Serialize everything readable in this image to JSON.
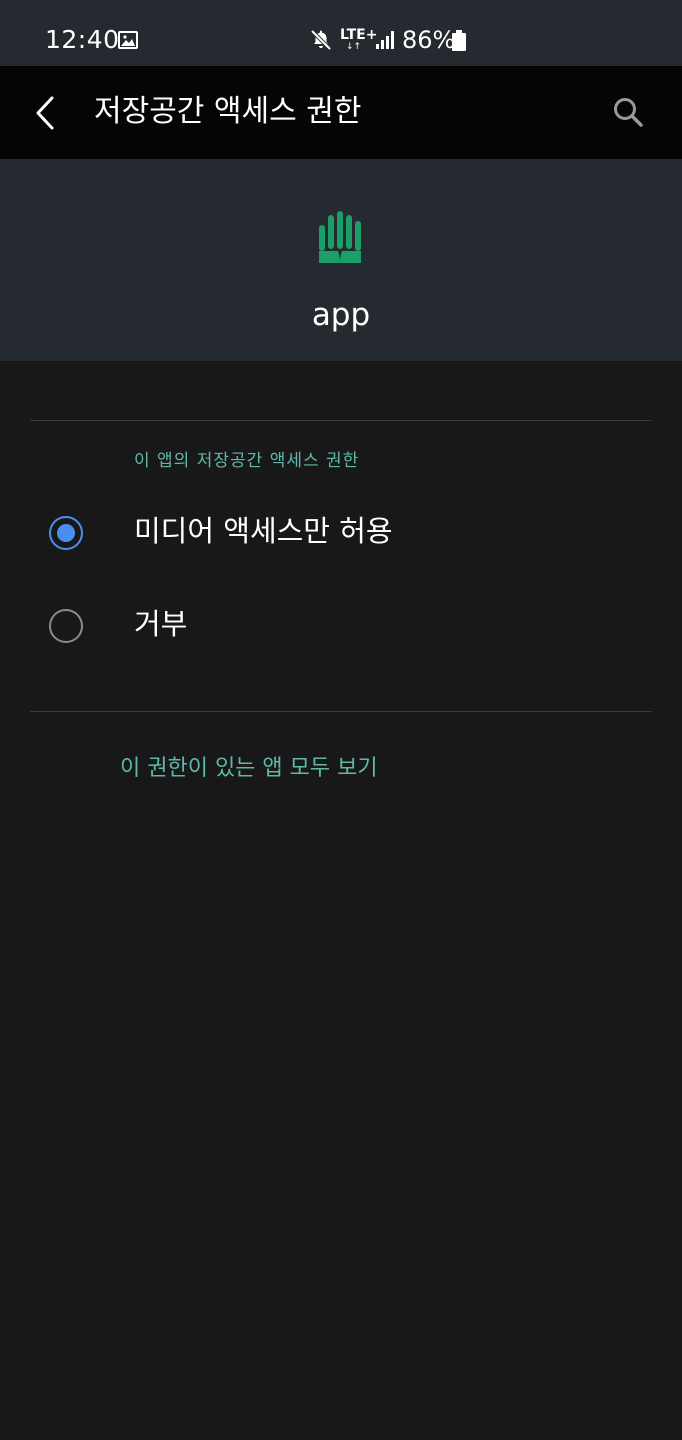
{
  "status_bar": {
    "time": "12:40",
    "network": "LTE+",
    "network_arrows": "↓↑",
    "battery": "86%",
    "icons": [
      "gallery-icon",
      "mute-icon",
      "signal-icon",
      "battery-icon"
    ]
  },
  "app_bar": {
    "title": "저장공간 액세스 권한",
    "back_icon": "back-arrow-icon",
    "search_icon": "search-icon"
  },
  "app_header": {
    "app_name": "app",
    "icon": "hand-icon",
    "icon_color": "#1a9f68"
  },
  "permission": {
    "section_title": "이 앱의 저장공간 액세스 권한",
    "options": [
      {
        "label": "미디어 액세스만 허용",
        "selected": true
      },
      {
        "label": "거부",
        "selected": false
      }
    ]
  },
  "footer": {
    "see_all_link": "이 권한이 있는 앱 모두 보기"
  },
  "colors": {
    "accent_teal": "#5fb8aa",
    "radio_selected": "#4a8ff0",
    "header_bg": "#252a30",
    "page_bg": "#181818"
  }
}
